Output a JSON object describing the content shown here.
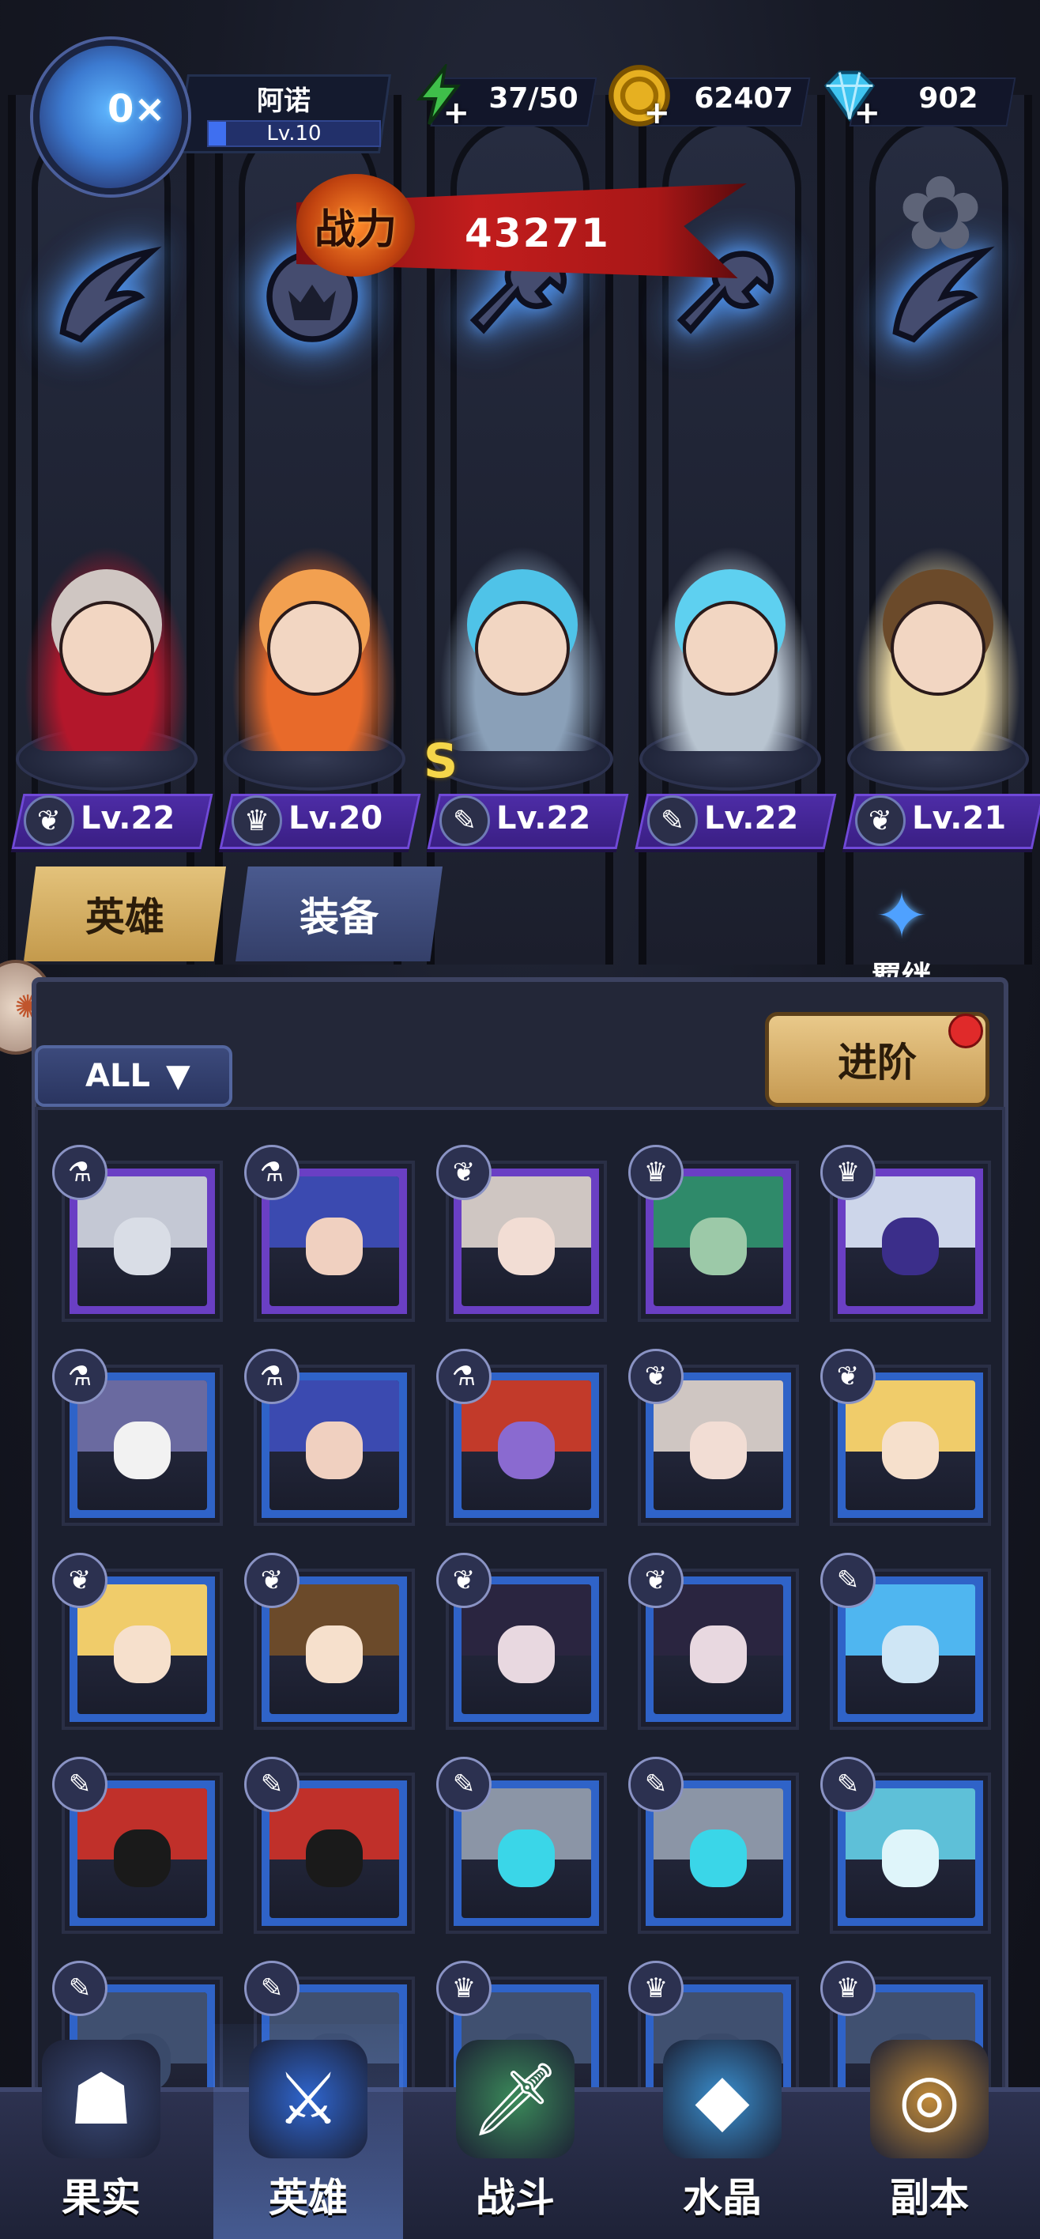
{
  "player": {
    "name": "阿诺",
    "level_label": "Lv.10",
    "level_progress": 0.1
  },
  "resources": {
    "stamina": {
      "icon": "lightning-icon",
      "value": "37/50"
    },
    "gold": {
      "icon": "gold-coin-icon",
      "value": "62407"
    },
    "gems": {
      "icon": "diamond-icon",
      "value": "902"
    }
  },
  "power": {
    "badge": "战力",
    "value": "43271"
  },
  "lineup": [
    {
      "class_icon": "wing-icon",
      "level": "Lv.22",
      "rank": ""
    },
    {
      "class_icon": "beast-icon",
      "level": "Lv.20",
      "rank": ""
    },
    {
      "class_icon": "wrench-icon",
      "level": "Lv.22",
      "rank": "S"
    },
    {
      "class_icon": "wrench-icon",
      "level": "Lv.22",
      "rank": ""
    },
    {
      "class_icon": "wing-icon",
      "level": "Lv.21",
      "rank": ""
    }
  ],
  "tabs": {
    "heroes": "英雄",
    "equipment": "装备"
  },
  "bond": {
    "label": "羁绊",
    "icon": "bond-icon"
  },
  "filter": {
    "value": "ALL"
  },
  "advance": {
    "label": "进阶"
  },
  "roster": [
    {
      "class_icon": "flask-icon",
      "frame": "#6a3fc4"
    },
    {
      "class_icon": "flask-icon",
      "frame": "#6a3fc4"
    },
    {
      "class_icon": "wing-icon",
      "frame": "#6a3fc4"
    },
    {
      "class_icon": "beast-icon",
      "frame": "#6a3fc4"
    },
    {
      "class_icon": "beast-icon",
      "frame": "#6a3fc4"
    },
    {
      "class_icon": "flask-icon",
      "frame": "#2f63c8"
    },
    {
      "class_icon": "flask-icon",
      "frame": "#2f63c8"
    },
    {
      "class_icon": "flask-icon",
      "frame": "#2f63c8"
    },
    {
      "class_icon": "wing-icon",
      "frame": "#2f63c8"
    },
    {
      "class_icon": "wing-icon",
      "frame": "#2f63c8"
    },
    {
      "class_icon": "wing-icon",
      "frame": "#2f63c8"
    },
    {
      "class_icon": "wing-icon",
      "frame": "#2f63c8"
    },
    {
      "class_icon": "wing-icon",
      "frame": "#2f63c8"
    },
    {
      "class_icon": "wing-icon",
      "frame": "#2f63c8"
    },
    {
      "class_icon": "wrench-icon",
      "frame": "#2f63c8"
    },
    {
      "class_icon": "wrench-icon",
      "frame": "#2f63c8"
    },
    {
      "class_icon": "wrench-icon",
      "frame": "#2f63c8"
    },
    {
      "class_icon": "wrench-icon",
      "frame": "#2f63c8"
    },
    {
      "class_icon": "wrench-icon",
      "frame": "#2f63c8"
    },
    {
      "class_icon": "wrench-icon",
      "frame": "#2f63c8"
    },
    {
      "class_icon": "wrench-icon",
      "frame": "#2f63c8"
    },
    {
      "class_icon": "wrench-icon",
      "frame": "#2f63c8"
    },
    {
      "class_icon": "beast-icon",
      "frame": "#2f63c8"
    },
    {
      "class_icon": "beast-icon",
      "frame": "#2f63c8"
    },
    {
      "class_icon": "beast-icon",
      "frame": "#2f63c8"
    }
  ],
  "nav": [
    {
      "label": "果实",
      "icon": "fruit-icon",
      "active": false
    },
    {
      "label": "英雄",
      "icon": "hero-hat-icon",
      "active": true
    },
    {
      "label": "战斗",
      "icon": "sword-icon",
      "active": false
    },
    {
      "label": "水晶",
      "icon": "crystal-icon",
      "active": false
    },
    {
      "label": "副本",
      "icon": "portal-icon",
      "active": false
    }
  ],
  "colors": {
    "accent_purple": "#4d2ca6",
    "gold_tab": "#d9b46a",
    "power_red": "#c21d1d",
    "notification": "#e02a2a"
  }
}
